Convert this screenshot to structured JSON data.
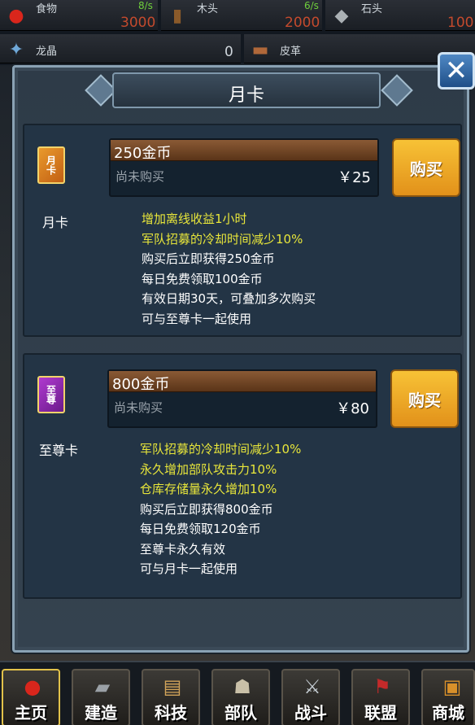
{
  "resources": {
    "food": {
      "name": "食物",
      "rate": "8/s",
      "value": "3000"
    },
    "wood": {
      "name": "木头",
      "rate": "6/s",
      "value": "2000"
    },
    "stone": {
      "name": "石头",
      "rate": "",
      "value": "100"
    },
    "crystal": {
      "name": "龙晶",
      "value": "0"
    },
    "leather": {
      "name": "皮革",
      "value": ""
    }
  },
  "modal": {
    "title": "月卡",
    "cards": [
      {
        "name": "月卡",
        "badge": "月卡",
        "gold": "250金币",
        "status": "尚未购买",
        "price": "￥25",
        "buy": "购买",
        "lines_yellow": [
          "增加离线收益1小时",
          "军队招募的冷却时间减少10%"
        ],
        "lines_white": [
          "购买后立即获得250金币",
          "每日免费领取100金币",
          "有效日期30天，可叠加多次购买",
          "可与至尊卡一起使用"
        ]
      },
      {
        "name": "至尊卡",
        "badge": "至尊",
        "gold": "800金币",
        "status": "尚未购买",
        "price": "￥80",
        "buy": "购买",
        "lines_yellow": [
          "军队招募的冷却时间减少10%",
          "永久增加部队攻击力10%",
          "仓库存储量永久增加10%"
        ],
        "lines_white": [
          "购买后立即获得800金币",
          "每日免费领取120金币",
          "至尊卡永久有效",
          "可与月卡一起使用"
        ]
      }
    ]
  },
  "nav": [
    "主页",
    "建造",
    "科技",
    "部队",
    "战斗",
    "联盟",
    "商城"
  ],
  "colors": {
    "accent_yellow": "#e8e63a",
    "buy_button": "#f2b22c",
    "gold_header": "#7a4d2b"
  }
}
